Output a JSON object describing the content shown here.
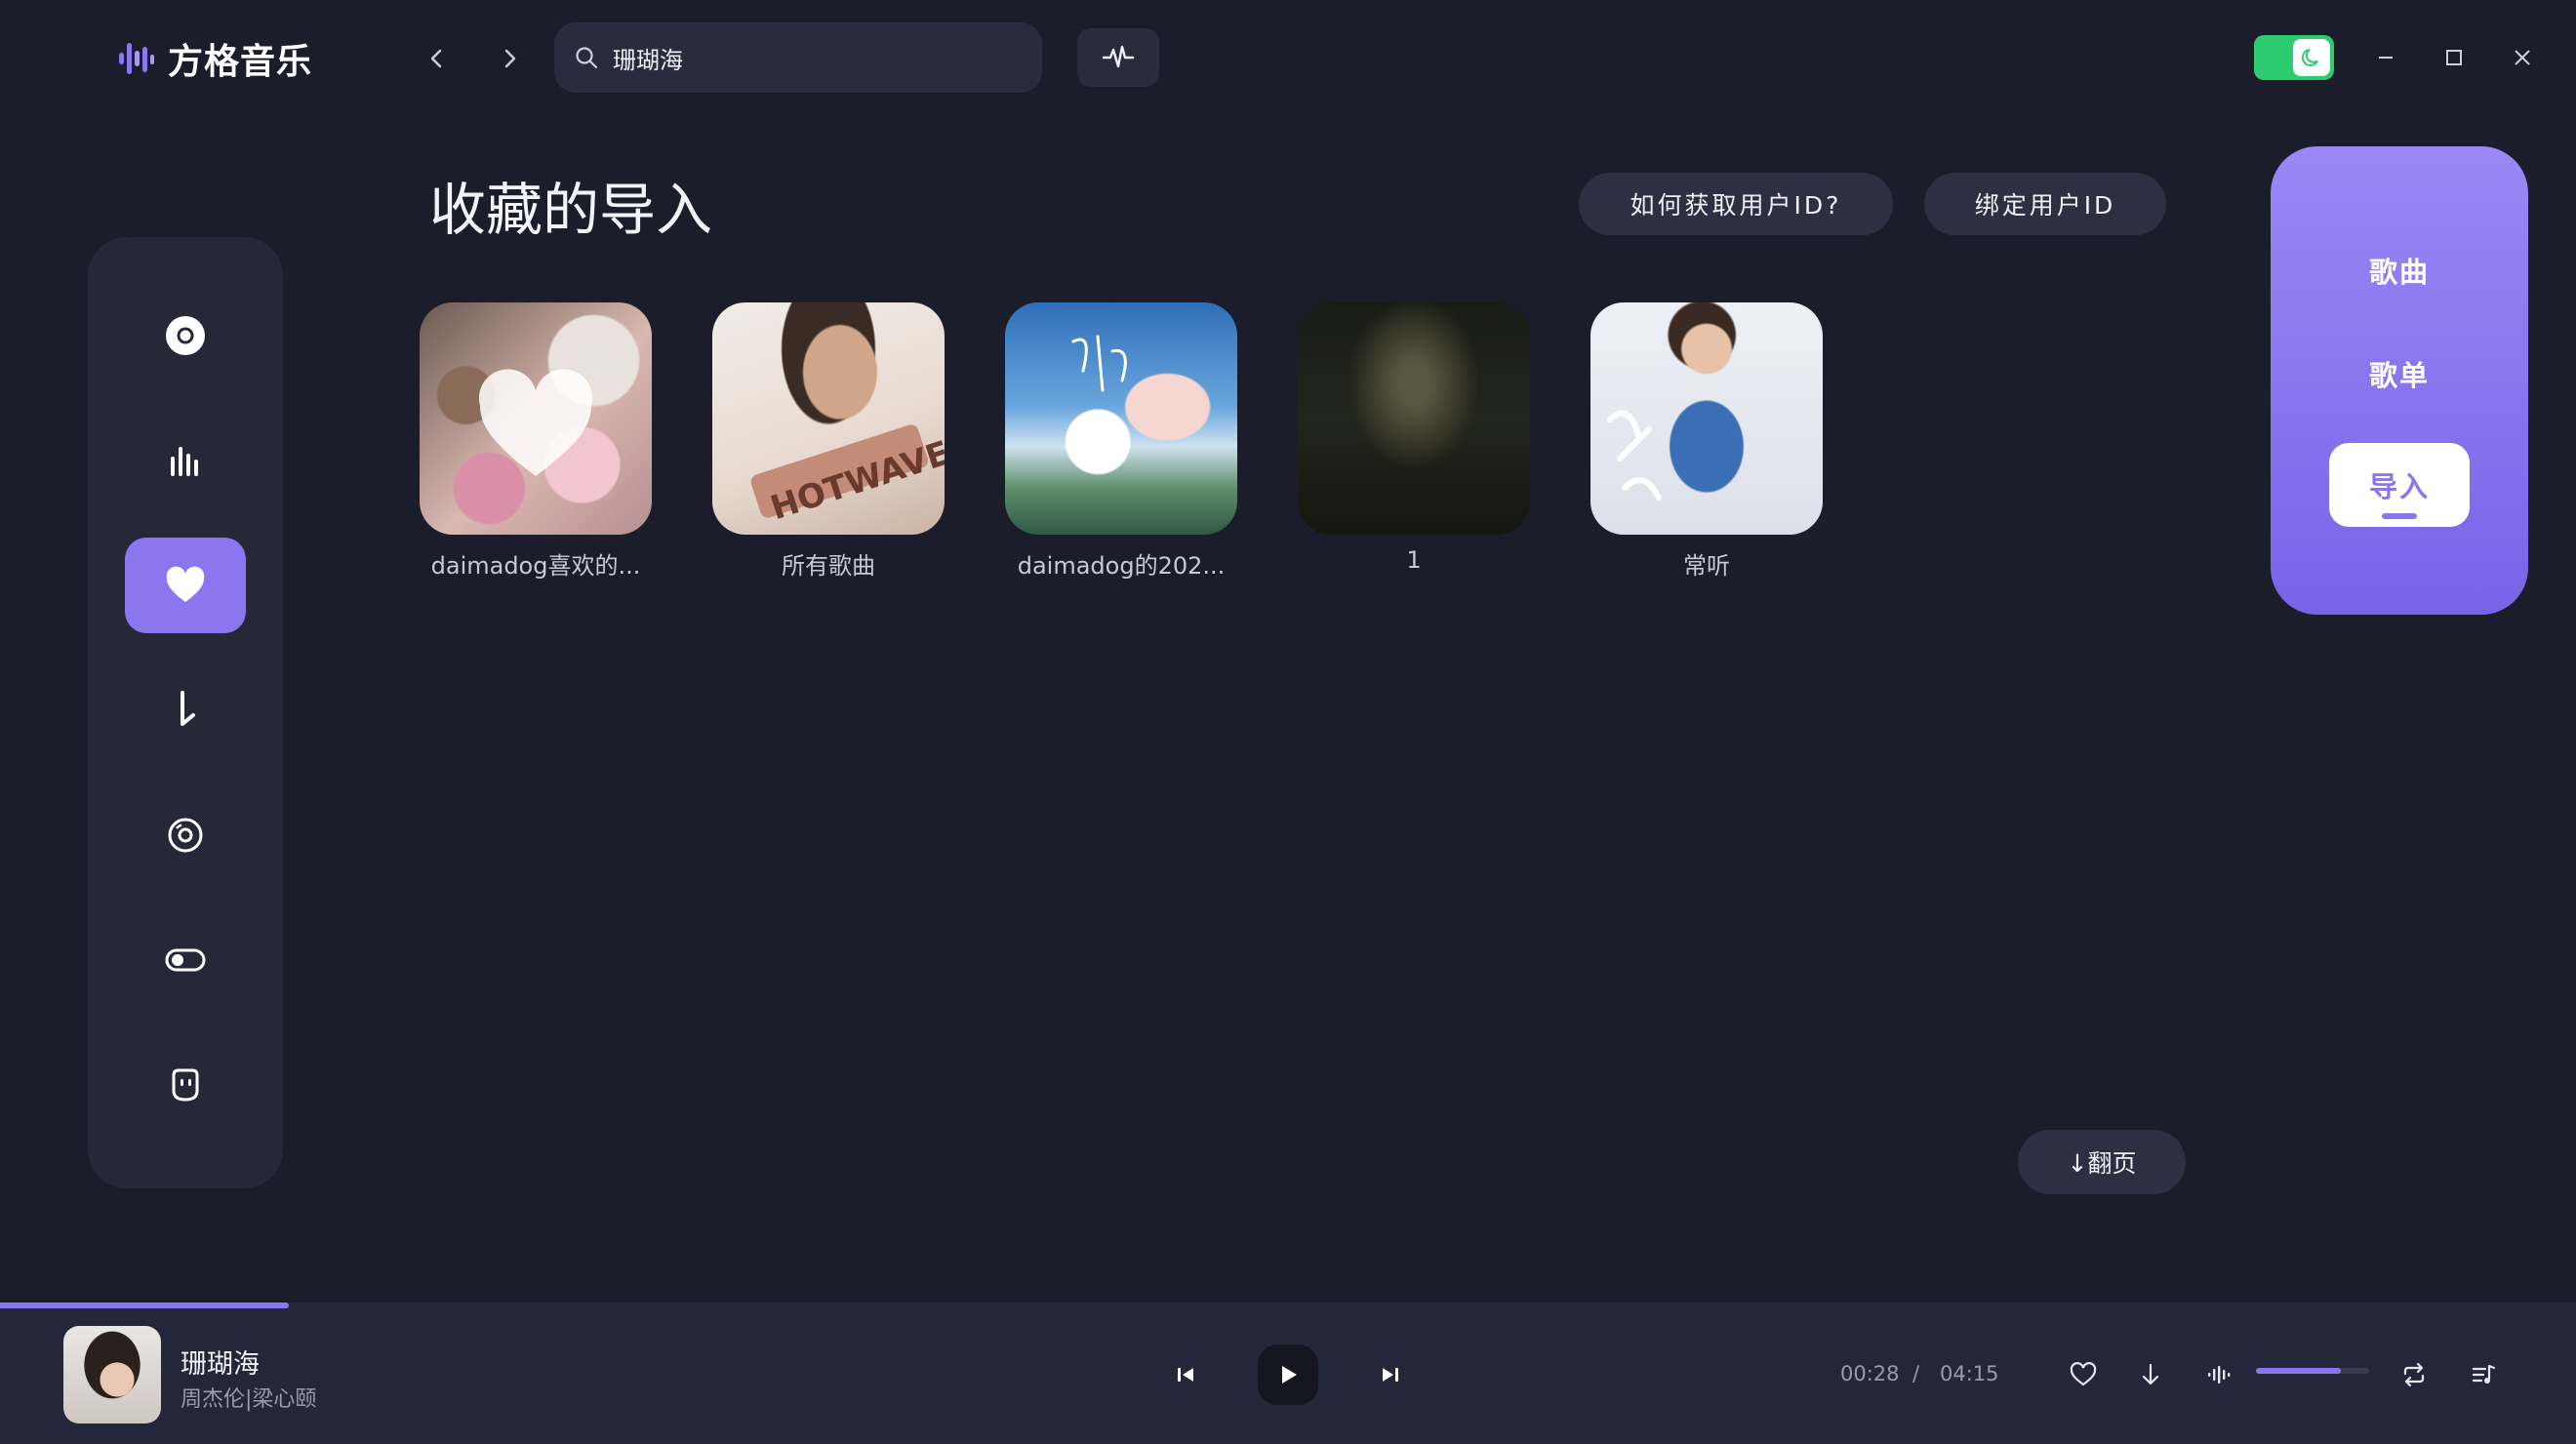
{
  "app": {
    "name": "方格音乐"
  },
  "search": {
    "value": "珊瑚海"
  },
  "page": {
    "title": "收藏的导入"
  },
  "actions": {
    "how_to_get_id": "如何获取用户ID?",
    "bind_id": "绑定用户ID"
  },
  "playlists": [
    {
      "label": "daimadog喜欢的..."
    },
    {
      "label": "所有歌曲"
    },
    {
      "label": "daimadog的202..."
    },
    {
      "label": "1"
    },
    {
      "label": "常听"
    }
  ],
  "pager": {
    "label": "↓翻页"
  },
  "tabs": [
    {
      "label": "歌曲",
      "active": false
    },
    {
      "label": "歌单",
      "active": false
    },
    {
      "label": "导入",
      "active": true
    }
  ],
  "sidebar": {
    "items": [
      {
        "icon": "disc-icon"
      },
      {
        "icon": "chart-bars-icon"
      },
      {
        "icon": "heart-icon",
        "active": true
      },
      {
        "icon": "download-icon"
      },
      {
        "icon": "cd-icon"
      },
      {
        "icon": "toggle-icon"
      },
      {
        "icon": "face-icon"
      }
    ]
  },
  "player": {
    "title": "珊瑚海",
    "artist": "周杰伦|梁心颐",
    "current_time": "00:28",
    "separator": "/",
    "total_time": "04:15",
    "progress": 0.112,
    "volume": 0.75
  },
  "colors": {
    "accent": "#8b76f0",
    "background": "#1c1d2a",
    "panel": "#262838",
    "toggle": "#2ecc71"
  }
}
